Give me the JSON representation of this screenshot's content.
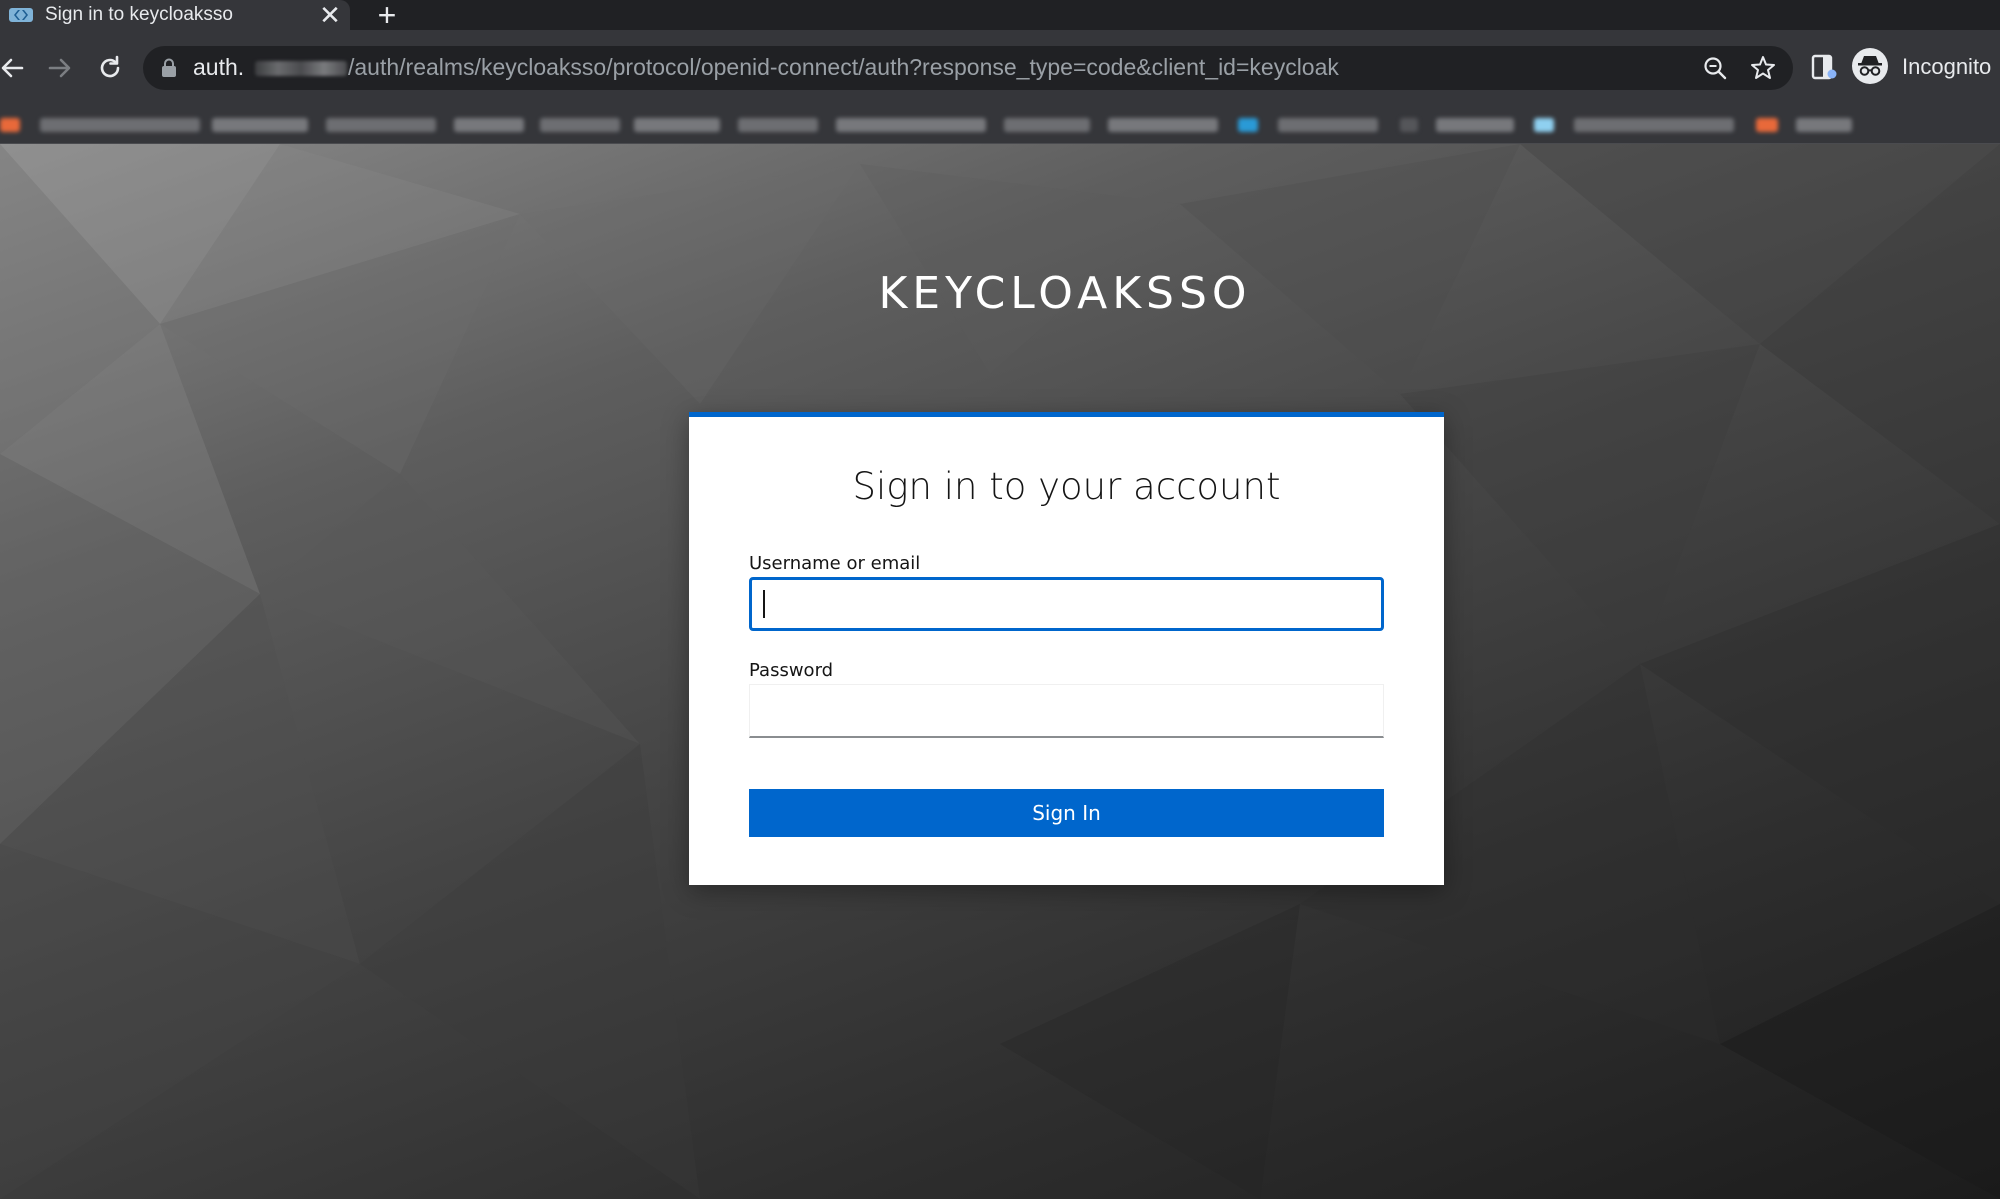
{
  "browser": {
    "tab": {
      "title": "Sign in to keycloaksso",
      "close_label": "✕",
      "new_tab_label": "+"
    },
    "address": {
      "host_prefix": "auth.",
      "path": "/auth/realms/keycloaksso/protocol/openid-connect/auth?response_type=code&client_id=keycloak"
    },
    "profile": {
      "label": "Incognito"
    },
    "icons": [
      "back-icon",
      "forward-icon",
      "reload-icon",
      "lock-icon",
      "zoom-icon",
      "bookmark-star-icon",
      "extension-icon",
      "incognito-icon"
    ]
  },
  "login": {
    "realm_name": "KEYCLOAKSSO",
    "heading": "Sign in to your account",
    "username_label": "Username or email",
    "username_value": "",
    "password_label": "Password",
    "password_value": "",
    "submit_label": "Sign In"
  },
  "colors": {
    "accent": "#0066cc",
    "browser_chrome": "#35363a",
    "tabstrip": "#202124"
  }
}
